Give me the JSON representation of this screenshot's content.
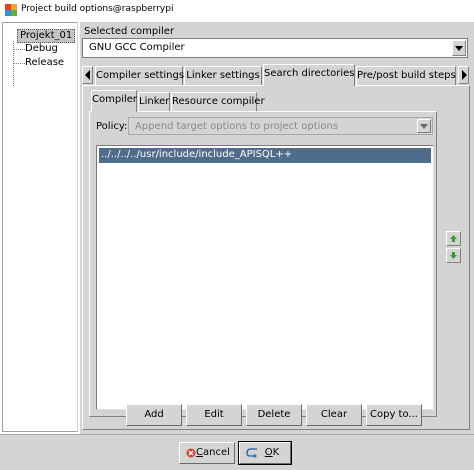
{
  "window": {
    "title": "Project build options@raspberrypi"
  },
  "tree": {
    "root": "Projekt_01",
    "children": [
      "Debug",
      "Release"
    ]
  },
  "compiler": {
    "label": "Selected compiler",
    "value": "GNU GCC Compiler"
  },
  "main_tabs": [
    {
      "label": "Compiler settings",
      "active": false
    },
    {
      "label": "Linker settings",
      "active": false
    },
    {
      "label": "Search directories",
      "active": true
    },
    {
      "label": "Pre/post build steps",
      "active": false
    }
  ],
  "sub_tabs": [
    {
      "label": "Compiler",
      "active": true
    },
    {
      "label": "Linker",
      "active": false
    },
    {
      "label": "Resource compiler",
      "active": false
    }
  ],
  "policy": {
    "label": "Policy:",
    "value": "Append target options to project options"
  },
  "directories": [
    "../../../../usr/include/include_APISQL++"
  ],
  "actions": {
    "add": "Add",
    "edit": "Edit",
    "delete": "Delete",
    "clear": "Clear",
    "copy_to": "Copy to..."
  },
  "dialog": {
    "cancel_first": "C",
    "cancel_rest": "ancel",
    "ok_first": "O",
    "ok_rest": "K"
  },
  "colors": {
    "selection": "#4f6c8a",
    "panel": "#d4d4d4",
    "arrow": "#3a9a3a"
  }
}
